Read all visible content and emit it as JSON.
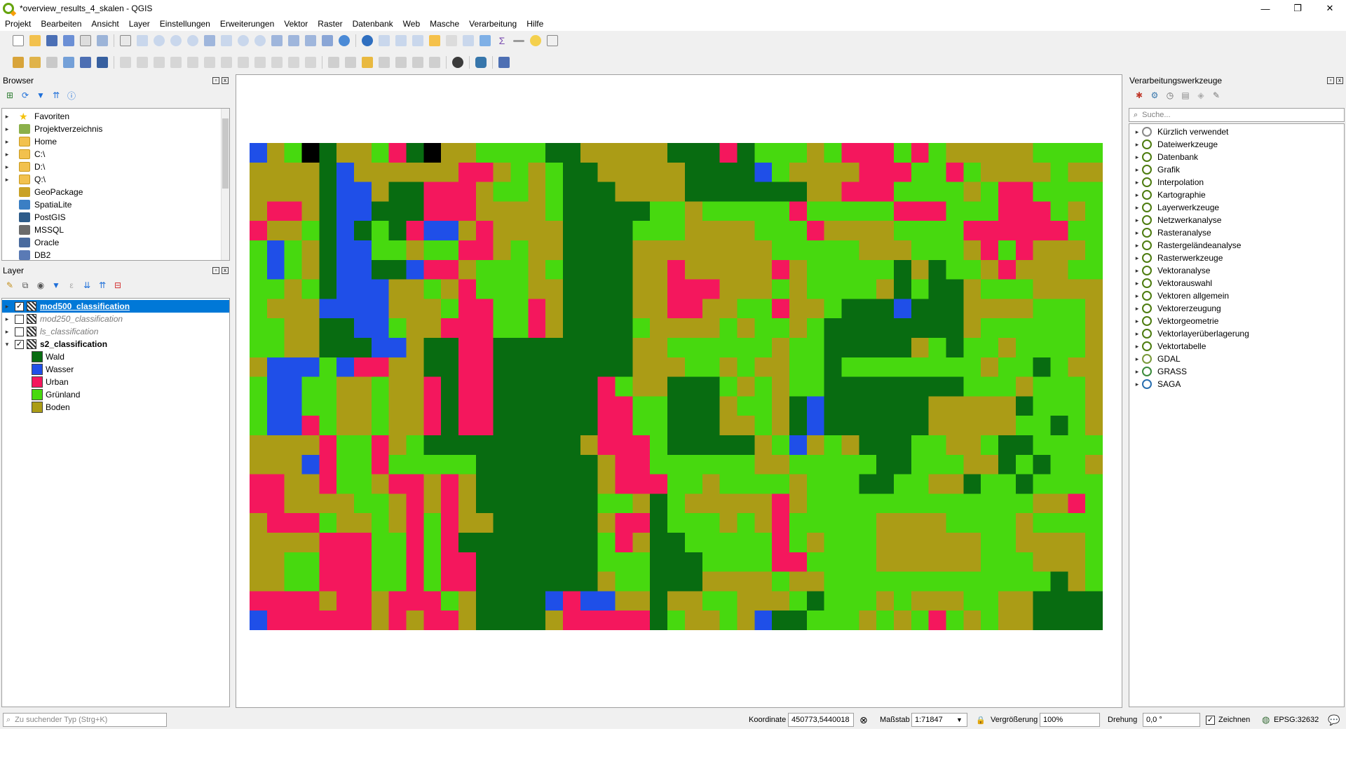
{
  "window": {
    "title": "*overview_results_4_skalen - QGIS",
    "controls": [
      "—",
      "❐",
      "✕"
    ]
  },
  "menu": [
    "Projekt",
    "Bearbeiten",
    "Ansicht",
    "Layer",
    "Einstellungen",
    "Erweiterungen",
    "Vektor",
    "Raster",
    "Datenbank",
    "Web",
    "Masche",
    "Verarbeitung",
    "Hilfe"
  ],
  "browser": {
    "title": "Browser",
    "items": [
      {
        "label": "Favoriten",
        "icon": "star-icon",
        "arrow": "▸"
      },
      {
        "label": "Projektverzeichnis",
        "icon": "project-folder-icon",
        "arrow": "▸"
      },
      {
        "label": "Home",
        "icon": "folder-icon",
        "arrow": "▸"
      },
      {
        "label": "C:\\",
        "icon": "folder-icon",
        "arrow": "▸"
      },
      {
        "label": "D:\\",
        "icon": "folder-icon",
        "arrow": "▸"
      },
      {
        "label": "Q:\\",
        "icon": "folder-icon",
        "arrow": "▸"
      },
      {
        "label": "GeoPackage",
        "icon": "geopackage-icon",
        "arrow": ""
      },
      {
        "label": "SpatiaLite",
        "icon": "spatialite-icon",
        "arrow": ""
      },
      {
        "label": "PostGIS",
        "icon": "postgis-icon",
        "arrow": ""
      },
      {
        "label": "MSSQL",
        "icon": "mssql-icon",
        "arrow": ""
      },
      {
        "label": "Oracle",
        "icon": "oracle-icon",
        "arrow": ""
      },
      {
        "label": "DB2",
        "icon": "db2-icon",
        "arrow": ""
      }
    ]
  },
  "layers": {
    "title": "Layer",
    "items": [
      {
        "label": "mod500_classification",
        "checked": true,
        "selected": true,
        "style": "bold-underline"
      },
      {
        "label": "mod250_classification",
        "checked": false,
        "selected": false,
        "style": "italic"
      },
      {
        "label": "ls_classification",
        "checked": false,
        "selected": false,
        "style": "italic"
      },
      {
        "label": "s2_classification",
        "checked": true,
        "selected": false,
        "style": "bold"
      }
    ],
    "legend": [
      {
        "label": "Wald",
        "color": "#086c11"
      },
      {
        "label": "Wasser",
        "color": "#1f4fe8"
      },
      {
        "label": "Urban",
        "color": "#f4175d"
      },
      {
        "label": "Grünland",
        "color": "#47d90f"
      },
      {
        "label": "Boden",
        "color": "#ab9c16"
      }
    ]
  },
  "processing": {
    "title": "Verarbeitungswerkzeuge",
    "search_placeholder": "Suche...",
    "items": [
      "Kürzlich verwendet",
      "Dateiwerkzeuge",
      "Datenbank",
      "Grafik",
      "Interpolation",
      "Kartographie",
      "Layerwerkzeuge",
      "Netzwerkanalyse",
      "Rasteranalyse",
      "Rastergeländeanalyse",
      "Rasterwerkzeuge",
      "Vektoranalyse",
      "Vektorauswahl",
      "Vektoren allgemein",
      "Vektorerzeugung",
      "Vektorgeometrie",
      "Vektorlayerüberlagerung",
      "Vektortabelle",
      "GDAL",
      "GRASS",
      "SAGA"
    ]
  },
  "status": {
    "locator_placeholder": "Zu suchender Typ (Strg+K)",
    "coord_label": "Koordinate",
    "coord_value": "450773,5440018",
    "scale_label": "Maßstab",
    "scale_value": "1:71847",
    "magnifier_label": "Vergrößerung",
    "magnifier_value": "100%",
    "rotation_label": "Drehung",
    "rotation_value": "0,0 °",
    "render_label": "Zeichnen",
    "crs": "EPSG:32632"
  },
  "map_palette": [
    "#086c11",
    "#1f4fe8",
    "#f4175d",
    "#47d90f",
    "#ab9c16"
  ],
  "map_rows": [
    "BDG4WDDGUW4DDGGGGWWDDDDDWWWUWGGGDGUUUGUGDDDDDGGGG",
    "DDDDWBDDDDDDUUDGDGWWDDDDDWWWWBGDDDDUUUGGUGDDDDGDD",
    "DDDDWBBDWWUUUDGGDGWWWDDDDWWWWWWWDDUUUGGGGDGUUGGGG",
    "DUUDWBBWWWUUUDDDDGWWWWWGGDGGGGGUGGGGGUUUGGGUUUGDG",
    "UDDGWBWGWUBBDUDDDDWWWWGGGDDDDGGGUDDDDGGGGUUUUUUGG",
    "GBGDWBBGGDGGUUDGDDWWWWDDDDDDDDGGGGGDDDGGGDUGUDDDG",
    "GBGDWBBWWBUUDGGGDGWWWWDDUDDDDDUDGGGGGWDWGGDUDDDGG",
    "GGDGWBBBDDGDUGGGDDWWWWDDUUUDDDGDGGGGDWGWWDGGGDDDD",
    "GDDDBBBBDDDGUUGGUDWWWWDDUUDDGGUDDGWWWBWWWDDDDGGGD",
    "GGDDWWBBGDDUUUGGUDWWWWGDDDDGDGGDGWWWWWWWWDGGGGGGD",
    "GGDDWWWBBDWWUUWWWWWWWWDDGGGGGGDGGWWWWWDGWGGDGGGGD",
    "DBBBGBUUDDWWUUWWWWWWWWDDDGGDGDDGGWGGGGGGGGDGGWGDD",
    "GBBGGDDGDDUWUUWWWWWWUGDDWWWGDGDGGWWWWWWWWGGGDGGGD",
    "GBBGGDDGDDUWUUWWWWWWUUGGWWWDGGDWBWWWWWWDDDDDWGGGD",
    "GBBUGDDGDDUWUUWWWWWWUUGGWWWDDGDWBWWWWWWDDDDDGGWGD",
    "DDDDUGGUDGWWWWWWWWWDUUUGWWWWWDGBDGDWWWGGDDGWWGGGG",
    "DDDBUGGUGGGGGWWWWWWWDUUGGGGGGDDGGGGGWWGGGDDWGWGGD",
    "UUDDUGGDUUDUDWWWWWWWDUUUGGDGGGGDGGGWWGGDDWGGWGGGG",
    "UUDDDDGGDUDUDWWWWWWWGGDWGDDDDDUDGGGGGGGGGGGGGDDUG",
    "DUUUGDDGDUGUDDWWWWWWDUUWGGGDGDUGGGGGDDDDGGGGDGGGG",
    "DDDDUUUGGUGUWWWWWWWWGUDWWGGGGGUGDGGGDDDDDDGGDDDDG",
    "DDGGUUUGGUGUUWWWWWWWGGGWWWGGGGUUGGGGDDDDDDGGGDDDG",
    "DDGGUUUGGUGUUWWWWWWWDGGWWWDDDDGDDGGGGGGGGGGGGGWDG",
    "UUUUDUUDUUUGDWWWWBUBBDDWDDGGDDDGWGGGDGDDDGGDDWWWW",
    "BUUUUUUDUDUUDWWWWDUUUUUWGDDGDBWWGGGDGDGUGDGDDWWWW"
  ]
}
